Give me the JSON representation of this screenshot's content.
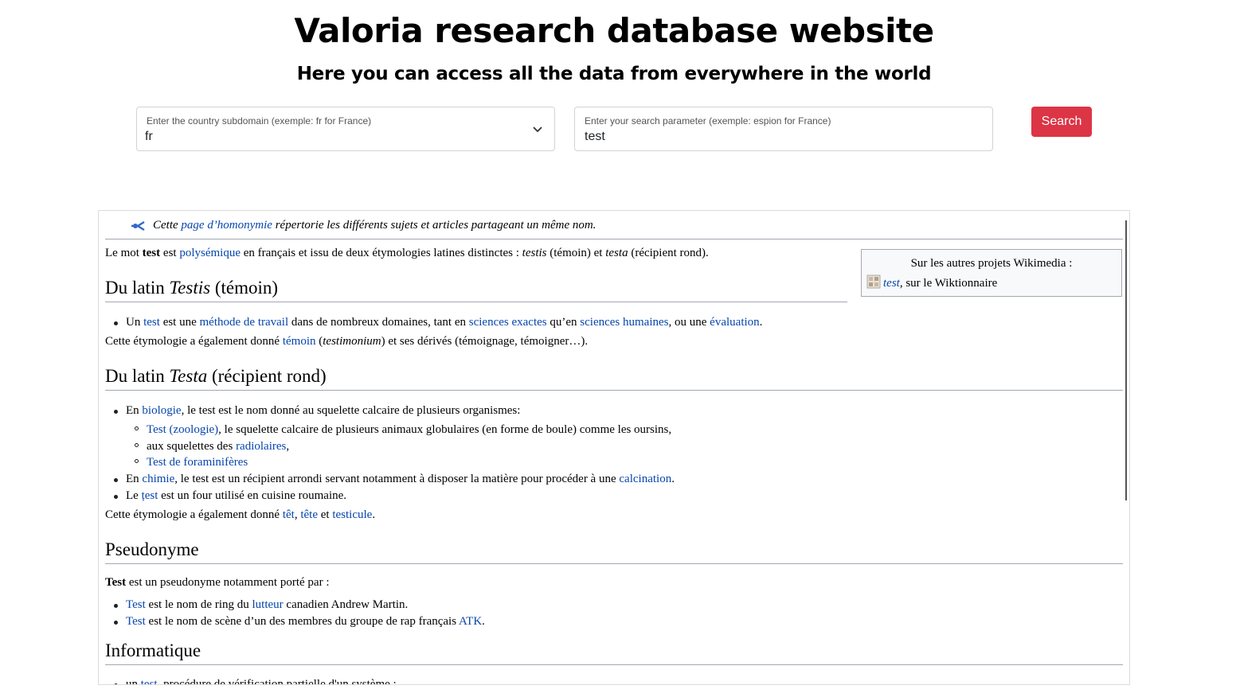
{
  "header": {
    "title": "Valoria research database website",
    "subtitle": "Here you can access all the data from everywhere in the world"
  },
  "form": {
    "country_label": "Enter the country subdomain (exemple: fr for France)",
    "country_value": "fr",
    "search_label": "Enter your search parameter (exemple: espion for France)",
    "search_value": "test",
    "search_button": "Search",
    "button_color": "#dc3545"
  },
  "article": {
    "hatnote": {
      "pre": "Cette ",
      "link": "page d’homonymie",
      "post": " répertorie les différents sujets et articles partageant un même nom."
    },
    "intro": {
      "t1": "Le mot ",
      "bold": "test",
      "t2": " est ",
      "link1": "polysémique",
      "t3": " en français et issu de deux étymologies latines distinctes : ",
      "i1": "testis",
      "t4": " (témoin) et ",
      "i2": "testa",
      "t5": " (récipient rond)."
    },
    "sister": {
      "title": "Sur les autres projets Wikimedia :",
      "link": "test",
      "text": ", sur le Wiktionnaire"
    },
    "h_testis": {
      "pre": "Du latin ",
      "it": "Testis",
      "post": " (témoin)"
    },
    "testis_item": {
      "t1": "Un ",
      "l1": "test",
      "t2": " est une ",
      "l2": "méthode de travail",
      "t3": " dans de nombreux domaines, tant en ",
      "l3": "sciences exactes",
      "t4": " qu’en ",
      "l4": "sciences humaines",
      "t5": ", ou une ",
      "l5": "évaluation",
      "t6": "."
    },
    "testis_etym": {
      "t1": "Cette étymologie a également donné ",
      "l1": "témoin",
      "t2": " (",
      "i1": "testimonium",
      "t3": ") et ses dérivés (témoignage, témoigner…)."
    },
    "h_testa": {
      "pre": "Du latin ",
      "it": "Testa",
      "post": " (récipient rond)"
    },
    "testa_bio": {
      "t1": "En ",
      "l1": "biologie",
      "t2": ", le test est le nom donné au squelette calcaire de plusieurs organismes:"
    },
    "testa_sub1": {
      "l1": "Test (zoologie)",
      "t1": ", le squelette calcaire de plusieurs animaux globulaires (en forme de boule) comme les oursins,"
    },
    "testa_sub2": {
      "t1": "aux squelettes des ",
      "l1": "radiolaires",
      "t2": ","
    },
    "testa_sub3": {
      "l1": "Test de foraminifères"
    },
    "testa_chem": {
      "t1": "En ",
      "l1": "chimie",
      "t2": ", le test est un récipient arrondi servant notamment à disposer la matière pour procéder à une ",
      "l2": "calcination",
      "t3": "."
    },
    "testa_oven": {
      "t1": "Le ",
      "l1": "țest",
      "t2": " est un four utilisé en cuisine roumaine."
    },
    "testa_etym": {
      "t1": "Cette étymologie a également donné ",
      "l1": "têt",
      "t2": ", ",
      "l2": "tête",
      "t3": " et ",
      "l3": "testicule",
      "t4": "."
    },
    "h_pseudo": "Pseudonyme",
    "pseudo_intro": {
      "bold": "Test",
      "t1": " est un pseudonyme notamment porté par :"
    },
    "pseudo_1": {
      "l1": "Test",
      "t1": " est le nom de ring du ",
      "l2": "lutteur",
      "t2": " canadien Andrew Martin."
    },
    "pseudo_2": {
      "l1": "Test",
      "t1": " est le nom de scène d’un des membres du groupe de rap français ",
      "l2": "ATK",
      "t2": "."
    },
    "h_info": "Informatique",
    "info_1": {
      "t1": "un ",
      "l1": "test",
      "t2": ", procédure de vérification partielle d'un système ;"
    }
  }
}
